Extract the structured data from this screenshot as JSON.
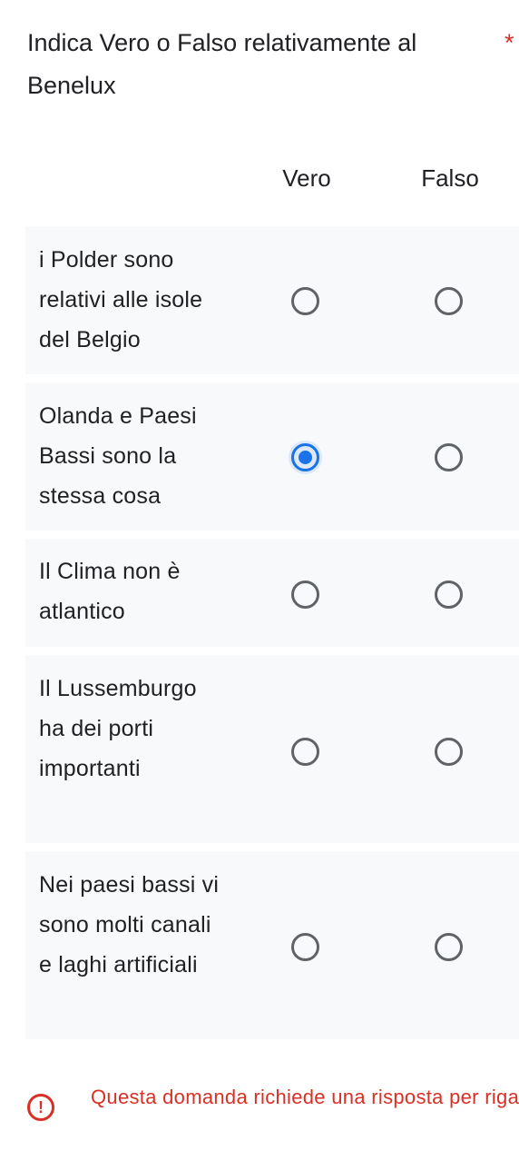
{
  "question": {
    "title": "Indica Vero o Falso relativamente al Benelux",
    "required_marker": "*"
  },
  "columns": [
    "Vero",
    "Falso"
  ],
  "rows": [
    {
      "label": "i Polder sono relativi alle isole del Belgio",
      "selected": null
    },
    {
      "label": "Olanda e Paesi Bassi sono la stessa cosa",
      "selected": "Vero"
    },
    {
      "label": "Il Clima non è atlantico",
      "selected": null
    },
    {
      "label": "Il Lussemburgo ha dei porti importanti",
      "selected": null
    },
    {
      "label": "Nei paesi bassi vi sono molti canali e laghi artificiali",
      "selected": null
    }
  ],
  "error": {
    "icon": "!",
    "message": "Questa domanda richiede una risposta per riga"
  },
  "colors": {
    "accent": "#1a73e8",
    "error": "#d93025",
    "radio_border": "#5f6368",
    "row_background": "#f8f9fa"
  }
}
